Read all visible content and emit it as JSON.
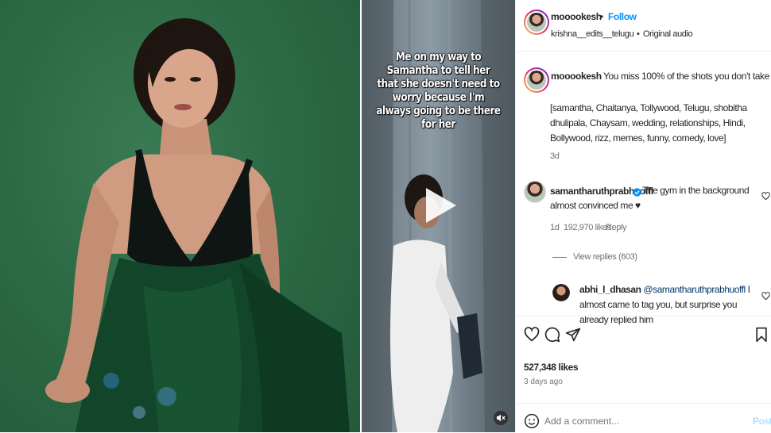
{
  "post": {
    "username": "mooookesh",
    "follow_label": "Follow",
    "separator": "•",
    "audio_artist": "krishna__edits__telugu",
    "audio_title": "Original audio"
  },
  "video": {
    "overlay_text": "Me on my way to Samantha to tell her that she doesn't need to worry because I'm always going to be there for her"
  },
  "caption": {
    "username": "mooookesh",
    "text": "You miss 100% of the shots you don't take 😇",
    "tags": "[samantha, Chaitanya, Tollywood, Telugu, shobitha dhulipala, Chaysam, wedding, relationships, Hindi, Bollywood, rizz, memes, funny, comedy, love]",
    "age": "3d"
  },
  "comments": [
    {
      "username": "samantharuthprabhuoffl",
      "verified": true,
      "text": "The gym in the background almost convinced me ♥",
      "age": "1d",
      "likes": "192,970 likes",
      "reply_label": "Reply",
      "view_replies": "View replies (603)"
    },
    {
      "username": "abhi_l_dhasan",
      "mention": "@samantharuthprabhuoffl",
      "text_line1": "I almost",
      "text_line2": "came to tag you, but surprise you already replied him"
    }
  ],
  "stats": {
    "likes": "527,348 likes",
    "date": "3 days ago"
  },
  "comment_input": {
    "placeholder": "Add a comment...",
    "post_label": "Post"
  },
  "icons": [
    "heart-icon",
    "comment-icon",
    "share-icon",
    "save-icon",
    "emoji-icon",
    "play-icon",
    "mute-icon",
    "verified-icon"
  ],
  "colors": {
    "accent": "#0095f6",
    "muted": "#737373",
    "mention": "#00376b",
    "backdrop": "#2c6a45"
  }
}
